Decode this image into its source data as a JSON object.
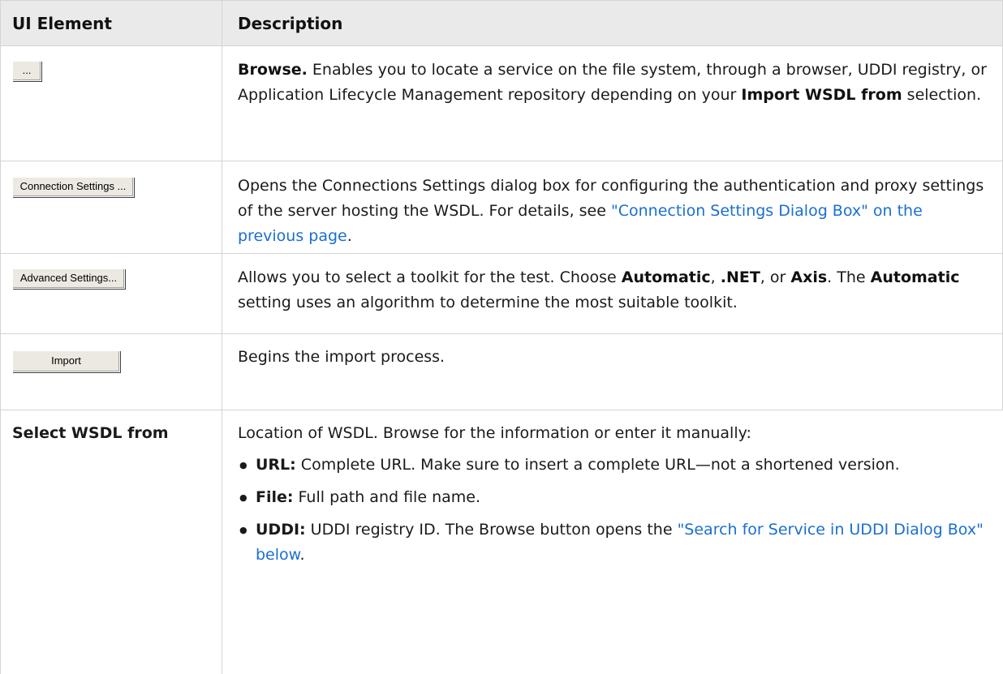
{
  "header": {
    "col1": "UI Element",
    "col2": "Description"
  },
  "rows": {
    "browse": {
      "button_label": "...",
      "bold1": "Browse.",
      "text1": " Enables you to locate a service on the file system, through a browser, UDDI registry, or Application Lifecycle Management repository depending on your ",
      "bold2": "Import WSDL from",
      "text2": " selection."
    },
    "connection": {
      "button_label": "Connection Settings ...",
      "text1": "Opens the Connections Settings dialog box for configuring the authentication and proxy settings of the server hosting the WSDL. For details, see ",
      "link": "\"Connection Settings Dialog Box\" on the previous page",
      "text2": "."
    },
    "advanced": {
      "button_label": "Advanced Settings...",
      "text1": "Allows you to select a toolkit for the test. Choose ",
      "bold1": "Automatic",
      "text2": ", ",
      "bold2": ".NET",
      "text3": ", or ",
      "bold3": "Axis",
      "text4": ". The ",
      "bold4": "Automatic",
      "text5": " setting uses an algorithm to determine the most suitable toolkit."
    },
    "import": {
      "button_label": "Import",
      "text": "Begins the import process."
    },
    "select": {
      "label": "Select WSDL from",
      "intro": "Location of WSDL. Browse for the information or enter it manually:",
      "bullets": {
        "url": {
          "term": "URL:",
          "text": " Complete URL. Make sure to insert a complete URL—not a shortened version."
        },
        "file": {
          "term": "File:",
          "text": " Full path and file name."
        },
        "uddi": {
          "term": "UDDI:",
          "text": " UDDI registry ID. The Browse button opens the ",
          "link": "\"Search for Service in UDDI Dialog Box\" below",
          "text2": "."
        }
      }
    }
  },
  "colors": {
    "link": "#1a6fd1",
    "header_bg": "#eaeaea",
    "border": "#d4d4d4"
  }
}
